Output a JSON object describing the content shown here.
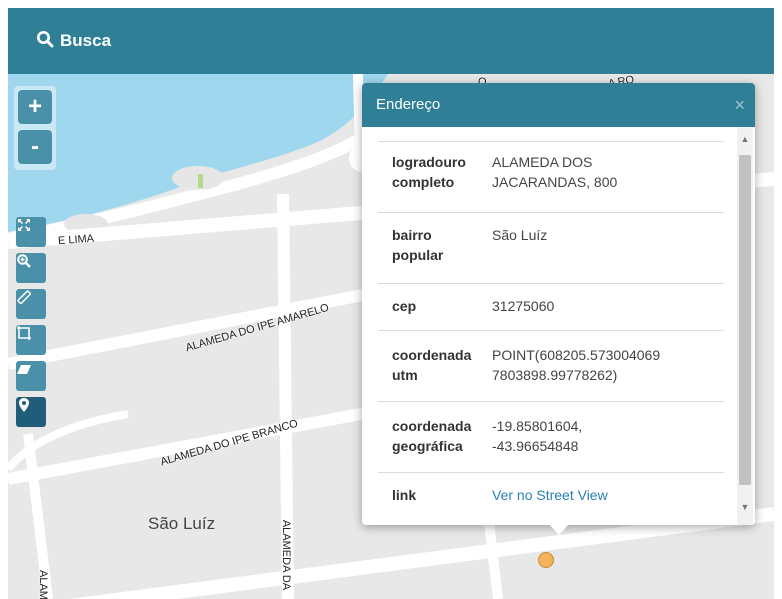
{
  "topbar": {
    "search_label": "Busca"
  },
  "map_controls": {
    "zoom_in": "+",
    "zoom_out": "-",
    "tools": [
      "expand-icon",
      "zoom-search-icon",
      "ruler-icon",
      "crop-icon",
      "eraser-icon",
      "location-pin-icon"
    ]
  },
  "map_labels": {
    "street_lima": "E LIMA",
    "street_amarelo": "ALAMEDA DO IPE AMARELO",
    "street_branco": "ALAMEDA DO IPE BRANCO",
    "neighborhood": "São Luíz",
    "street_vertical": "ALAMEDA DA",
    "street_left": "ALAM",
    "street_top_o": "O",
    "street_top_right": "A RO"
  },
  "popup": {
    "title": "Endereço",
    "close": "×",
    "rows": [
      {
        "key_line1": "logradouro",
        "key_line2": "completo",
        "value_line1": "ALAMEDA DOS",
        "value_line2": "JACARANDAS, 800"
      },
      {
        "key_line1": "bairro",
        "key_line2": "popular",
        "value_line1": "São Luíz",
        "value_line2": ""
      },
      {
        "key_line1": "cep",
        "key_line2": "",
        "value_line1": "31275060",
        "value_line2": ""
      },
      {
        "key_line1": "coordenada",
        "key_line2": "utm",
        "value_line1": "POINT(608205.573004069",
        "value_line2": "7803898.99778262)"
      },
      {
        "key_line1": "coordenada",
        "key_line2": "geográfica",
        "value_line1": "-19.85801604,",
        "value_line2": "-43.96654848"
      },
      {
        "key_line1": "link",
        "key_line2": "",
        "value_line1": "Ver no Street View",
        "value_line2": ""
      }
    ]
  },
  "colors": {
    "header": "#2f7f97",
    "water": "#9fd7ef",
    "road": "#ffffff",
    "marker": "#f2b35a"
  }
}
